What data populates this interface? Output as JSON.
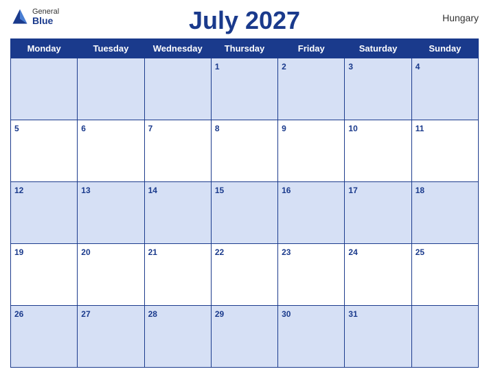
{
  "header": {
    "title": "July 2027",
    "country": "Hungary",
    "logo": {
      "general": "General",
      "blue": "Blue"
    }
  },
  "weekdays": [
    "Monday",
    "Tuesday",
    "Wednesday",
    "Thursday",
    "Friday",
    "Saturday",
    "Sunday"
  ],
  "weeks": [
    [
      null,
      null,
      null,
      1,
      2,
      3,
      4
    ],
    [
      5,
      6,
      7,
      8,
      9,
      10,
      11
    ],
    [
      12,
      13,
      14,
      15,
      16,
      17,
      18
    ],
    [
      19,
      20,
      21,
      22,
      23,
      24,
      25
    ],
    [
      26,
      27,
      28,
      29,
      30,
      31,
      null
    ]
  ]
}
